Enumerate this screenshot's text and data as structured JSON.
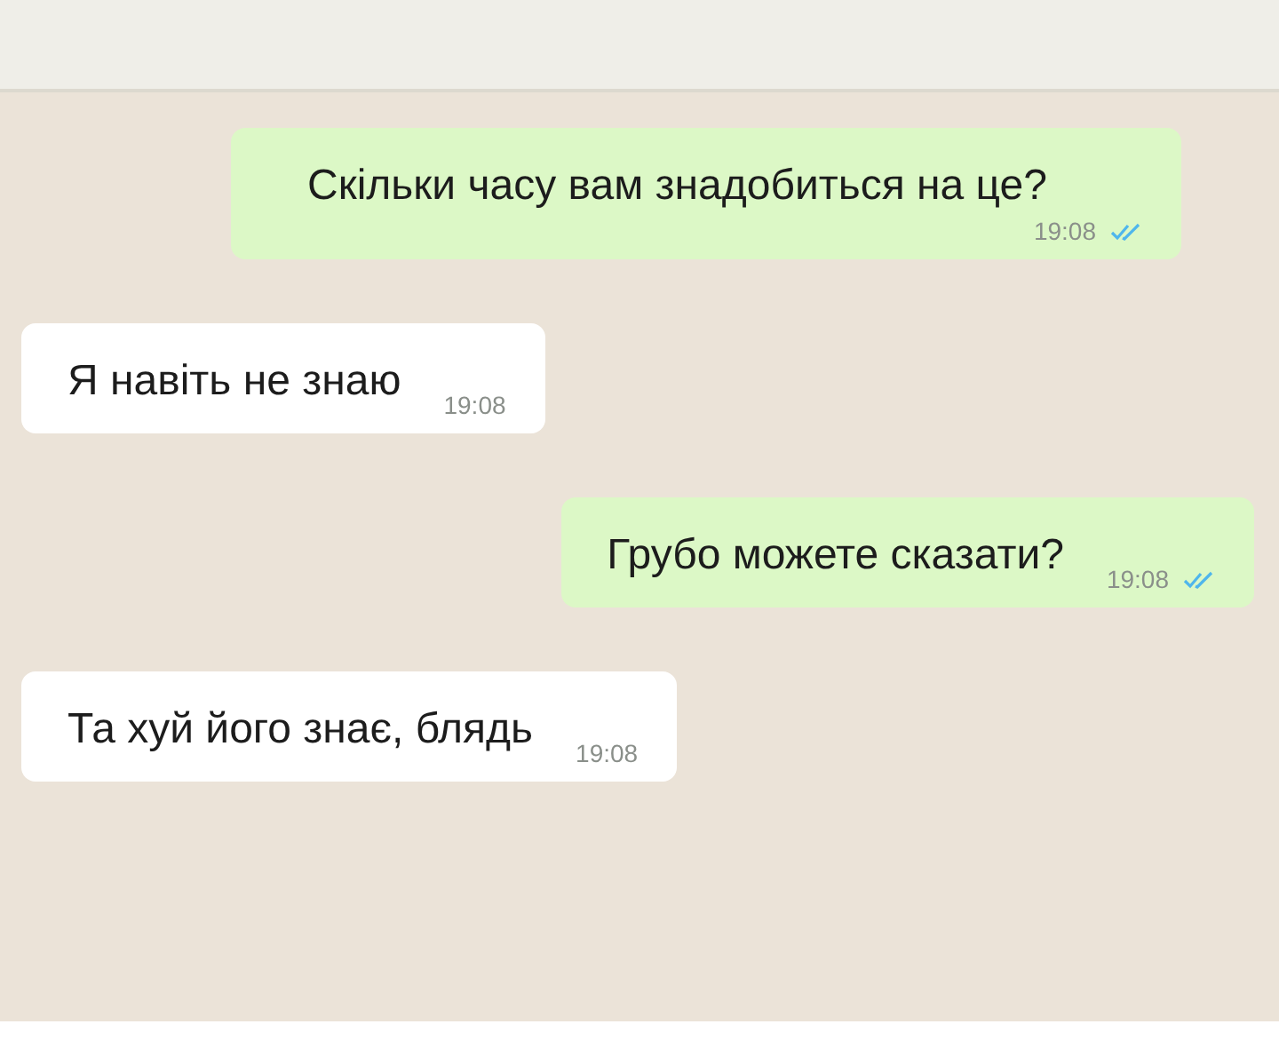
{
  "messages": [
    {
      "kind": "outgoing",
      "text": "Скільки часу вам знадобиться на це?",
      "time": "19:08",
      "read": true
    },
    {
      "kind": "incoming",
      "text": "Я навіть не знаю",
      "time": "19:08"
    },
    {
      "kind": "outgoing",
      "text": "Грубо можете сказати?",
      "time": "19:08",
      "read": true
    },
    {
      "kind": "incoming",
      "text": "Та хуй його знає, блядь",
      "time": "19:08"
    }
  ]
}
